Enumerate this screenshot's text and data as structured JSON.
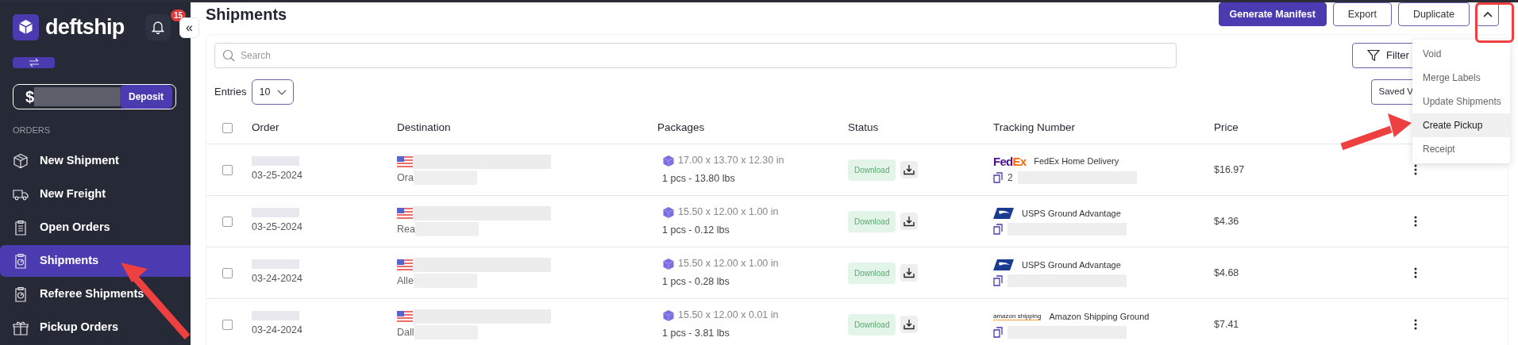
{
  "sidebar": {
    "brand": "deftship",
    "notifications": "15",
    "collapse": "«",
    "balance": {
      "currency": "$",
      "button": "Deposit"
    },
    "section": "ORDERS",
    "items": [
      {
        "label": "New Shipment",
        "kind": "box",
        "selected": false
      },
      {
        "label": "New Freight",
        "kind": "truck",
        "selected": false
      },
      {
        "label": "Open Orders",
        "kind": "clipboard",
        "selected": false
      },
      {
        "label": "Shipments",
        "kind": "dial",
        "selected": true
      },
      {
        "label": "Referee Shipments",
        "kind": "dial",
        "selected": false
      },
      {
        "label": "Pickup Orders",
        "kind": "gift",
        "selected": false
      }
    ]
  },
  "header": {
    "title": "Shipments",
    "buttons": [
      {
        "label": "Generate Manifest",
        "kind": "primary"
      },
      {
        "label": "Export",
        "kind": "outline"
      },
      {
        "label": "Duplicate",
        "kind": "outline"
      }
    ],
    "more_menu": {
      "expanded": true,
      "items": [
        {
          "label": "Void",
          "selected": false
        },
        {
          "label": "Merge Labels",
          "selected": false
        },
        {
          "label": "Update Shipments",
          "selected": false
        },
        {
          "label": "Create Pickup",
          "selected": true
        },
        {
          "label": "Receipt",
          "selected": false
        }
      ]
    }
  },
  "toolbar": {
    "search": {
      "placeholder": "Search"
    },
    "filter": "Filter",
    "entries_label": "Entries",
    "entries_value": "10",
    "saved_views": "Saved V"
  },
  "table": {
    "all_checked": false,
    "columns": [
      "Order",
      "Destination",
      "Packages",
      "Status",
      "Tracking Number",
      "Price"
    ],
    "rows": [
      {
        "checked": false,
        "date": "03-25-2024",
        "city": "Ora",
        "dims": "17.00 x 13.70 x 12.30 in",
        "weight": "1 pcs - 13.80 lbs",
        "status": "Download",
        "carrier": {
          "kind": "fedex",
          "text": [
            "Fed",
            "Ex"
          ]
        },
        "service": "FedEx Home Delivery",
        "tracking": "2",
        "price": "$16.97"
      },
      {
        "checked": false,
        "date": "03-25-2024",
        "city": "Rea",
        "dims": "15.50 x 12.00 x 1.00 in",
        "weight": "1 pcs - 0.12 lbs",
        "status": "Download",
        "carrier": {
          "kind": "usps"
        },
        "service": "USPS Ground Advantage",
        "price": "$4.36"
      },
      {
        "checked": false,
        "date": "03-24-2024",
        "city": "Alle",
        "dims": "15.50 x 12.00 x 1.00 in",
        "weight": "1 pcs - 0.28 lbs",
        "status": "Download",
        "carrier": {
          "kind": "usps"
        },
        "service": "USPS Ground Advantage",
        "price": "$4.68"
      },
      {
        "checked": false,
        "date": "03-24-2024",
        "city": "Dall",
        "dims": "15.50 x 12.00 x 0.01 in",
        "weight": "1 pcs - 3.81 lbs",
        "status": "Download",
        "carrier": {
          "kind": "amazon",
          "text": [
            "amazon shipping"
          ]
        },
        "service": "Amazon Shipping Ground",
        "price": "$7.41"
      }
    ]
  }
}
